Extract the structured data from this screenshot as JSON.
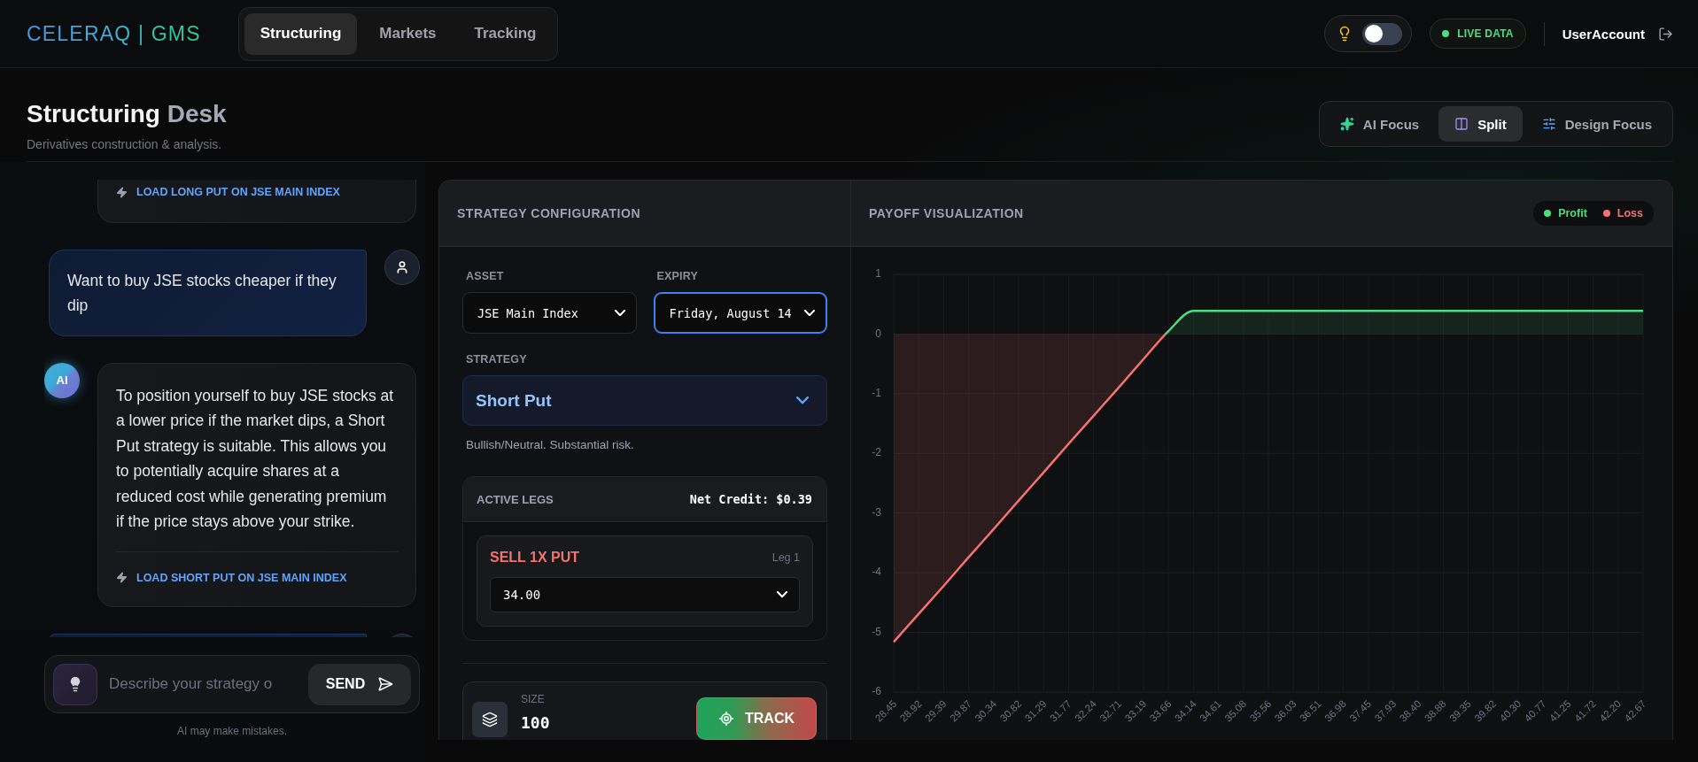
{
  "brand": {
    "logo": "CELERAQ | GMS"
  },
  "nav_tabs": [
    {
      "label": "Structuring",
      "selected": true
    },
    {
      "label": "Markets",
      "selected": false
    },
    {
      "label": "Tracking",
      "selected": false
    }
  ],
  "toolbar": {
    "theme_toggle": {
      "on": false
    },
    "live_status": "LIVE DATA",
    "user_name": "UserAccount"
  },
  "header": {
    "title": "Structuring",
    "title_accent": "Desk",
    "subtitle": "Derivatives construction & analysis."
  },
  "view_modes": [
    {
      "kind": "ai",
      "label": "AI Focus",
      "selected": false
    },
    {
      "kind": "split",
      "label": "Split",
      "selected": true
    },
    {
      "kind": "design",
      "label": "Design Focus",
      "selected": false
    }
  ],
  "chat": {
    "messages": [
      {
        "kind": "ai",
        "action": "LOAD LONG PUT ON JSE MAIN INDEX"
      },
      {
        "kind": "user",
        "text": "Want to buy JSE stocks cheaper if they dip"
      },
      {
        "kind": "ai",
        "avatar": "AI",
        "text": "To position yourself to buy JSE stocks at a lower price if the market dips, a Short Put strategy is suitable. This allows you to potentially acquire shares at a reduced cost while generating premium if the price stays above your strike.",
        "action": "LOAD SHORT PUT ON JSE MAIN INDEX"
      },
      {
        "kind": "user"
      }
    ],
    "input": {
      "placeholder": "Describe your strategy o"
    },
    "send_label": "SEND",
    "disclaimer": "AI may make mistakes."
  },
  "config": {
    "title": "STRATEGY CONFIGURATION",
    "asset": {
      "label": "ASSET",
      "value": "JSE Main Index",
      "focused": false
    },
    "expiry": {
      "label": "EXPIRY",
      "value": "Friday, August 14",
      "focused": true
    },
    "strategy": {
      "label": "STRATEGY",
      "value": "Short Put",
      "description": "Bullish/Neutral. Substantial risk."
    },
    "legs": {
      "title": "ACTIVE LEGS",
      "net": "Net Credit: $0.39",
      "items": [
        {
          "kind": "sell",
          "action": "SELL 1X PUT",
          "tag": "Leg 1",
          "strike": "34.00"
        }
      ]
    },
    "size": {
      "label": "SIZE",
      "value": "100"
    },
    "track_label": "TRACK"
  },
  "payoff": {
    "title": "PAYOFF VISUALIZATION",
    "legend": [
      {
        "label": "Profit",
        "color": "#4ade80"
      },
      {
        "label": "Loss",
        "color": "#f87171"
      }
    ],
    "chart_data": {
      "type": "area",
      "grid": true,
      "categories": [
        "28.45",
        "28.92",
        "29.39",
        "29.87",
        "30.34",
        "30.82",
        "31.29",
        "31.77",
        "32.24",
        "32.71",
        "33.19",
        "33.66",
        "34.14",
        "34.61",
        "35.08",
        "35.56",
        "36.03",
        "36.51",
        "36.98",
        "37.45",
        "37.93",
        "38.40",
        "38.88",
        "39.35",
        "39.82",
        "40.30",
        "40.77",
        "41.25",
        "41.72",
        "42.20",
        "42.67"
      ],
      "values": [
        -5.16,
        -4.69,
        -4.22,
        -3.74,
        -3.27,
        -2.79,
        -2.32,
        -1.84,
        -1.37,
        -0.9,
        -0.42,
        0.05,
        0.39,
        0.39,
        0.39,
        0.39,
        0.39,
        0.39,
        0.39,
        0.39,
        0.39,
        0.39,
        0.39,
        0.39,
        0.39,
        0.39,
        0.39,
        0.39,
        0.39,
        0.39,
        0.39
      ],
      "ylim": [
        -6,
        1
      ],
      "yticks": [
        1,
        0,
        -1,
        -2,
        -3,
        -4,
        -5,
        -6
      ]
    }
  }
}
